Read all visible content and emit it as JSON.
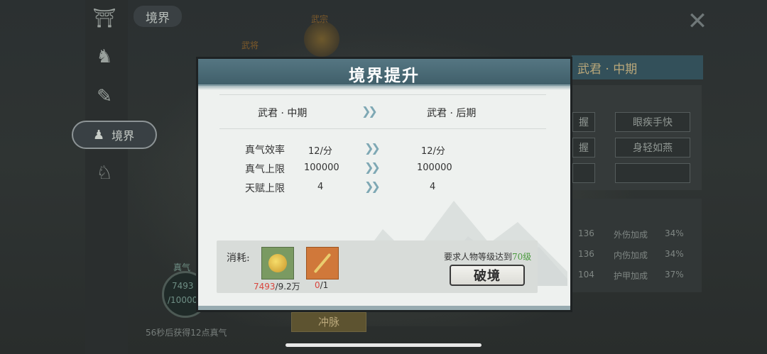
{
  "background": {
    "realm_tab": "境界",
    "sidebar_active_label": "境界",
    "right_header": "武君 · 中期",
    "skills": [
      "握",
      "眼疾手快",
      "握",
      "身轻如燕"
    ],
    "stats": [
      {
        "value": "136",
        "label": "外伤加成",
        "pct": "34%"
      },
      {
        "value": "136",
        "label": "内伤加成",
        "pct": "34%"
      },
      {
        "value": "104",
        "label": "护甲加成",
        "pct": "37%"
      }
    ],
    "orb_labels": [
      "武宗",
      "武将"
    ],
    "qi_label": "真气",
    "qi_value": "7493",
    "qi_max": "/10000",
    "qi_footer": "56秒后获得12点真气",
    "bottom_button": "冲脉"
  },
  "dialog": {
    "title": "境界提升",
    "from_stage": "武君 · 中期",
    "to_stage": "武君 · 后期",
    "attributes": [
      {
        "label": "真气效率",
        "from": "12/分",
        "to": "12/分"
      },
      {
        "label": "真气上限",
        "from": "100000",
        "to": "100000"
      },
      {
        "label": "天赋上限",
        "from": "4",
        "to": "4"
      }
    ],
    "cost_label": "消耗:",
    "costs": [
      {
        "icon": "gold-pill-icon",
        "have": "7493",
        "need": "/9.2万"
      },
      {
        "icon": "golden-rod-icon",
        "have": "0",
        "need": "/1"
      }
    ],
    "requirement_prefix": "要求人物等级达到",
    "requirement_level": "70级",
    "break_button": "破境"
  },
  "colors": {
    "header": "#4a6a75",
    "dialog_bg": "#eef1ef",
    "cost_red": "#d9463e",
    "level_green": "#4a9a3e",
    "arrow": "#7ea8b4"
  }
}
